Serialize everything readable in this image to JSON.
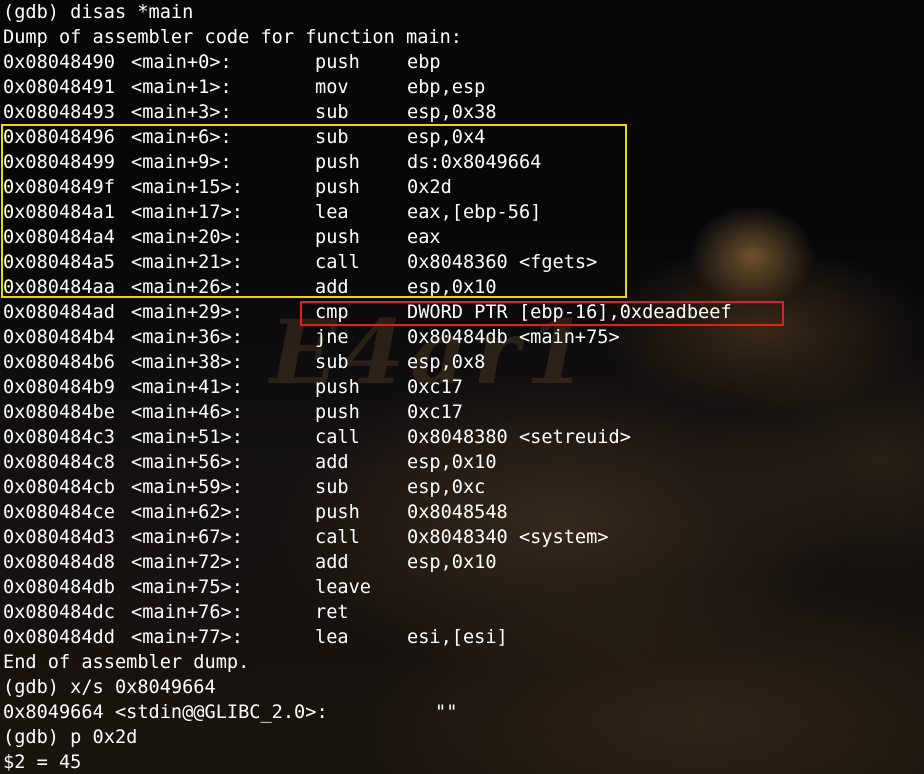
{
  "header": {
    "command": "(gdb) disas *main",
    "dump_title": "Dump of assembler code for function main:"
  },
  "instructions": [
    {
      "addr": "0x08048490",
      "offset": "<main+0>:",
      "mnemonic": "push",
      "operand": "ebp"
    },
    {
      "addr": "0x08048491",
      "offset": "<main+1>:",
      "mnemonic": "mov",
      "operand": "ebp,esp"
    },
    {
      "addr": "0x08048493",
      "offset": "<main+3>:",
      "mnemonic": "sub",
      "operand": "esp,0x38"
    },
    {
      "addr": "0x08048496",
      "offset": "<main+6>:",
      "mnemonic": "sub",
      "operand": "esp,0x4"
    },
    {
      "addr": "0x08048499",
      "offset": "<main+9>:",
      "mnemonic": "push",
      "operand": "ds:0x8049664"
    },
    {
      "addr": "0x0804849f",
      "offset": "<main+15>:",
      "mnemonic": "push",
      "operand": "0x2d"
    },
    {
      "addr": "0x080484a1",
      "offset": "<main+17>:",
      "mnemonic": "lea",
      "operand": "eax,[ebp-56]"
    },
    {
      "addr": "0x080484a4",
      "offset": "<main+20>:",
      "mnemonic": "push",
      "operand": "eax"
    },
    {
      "addr": "0x080484a5",
      "offset": "<main+21>:",
      "mnemonic": "call",
      "operand": "0x8048360 <fgets>"
    },
    {
      "addr": "0x080484aa",
      "offset": "<main+26>:",
      "mnemonic": "add",
      "operand": "esp,0x10"
    },
    {
      "addr": "0x080484ad",
      "offset": "<main+29>:",
      "mnemonic": "cmp",
      "operand": "DWORD PTR [ebp-16],0xdeadbeef"
    },
    {
      "addr": "0x080484b4",
      "offset": "<main+36>:",
      "mnemonic": "jne",
      "operand": "0x80484db <main+75>"
    },
    {
      "addr": "0x080484b6",
      "offset": "<main+38>:",
      "mnemonic": "sub",
      "operand": "esp,0x8"
    },
    {
      "addr": "0x080484b9",
      "offset": "<main+41>:",
      "mnemonic": "push",
      "operand": "0xc17"
    },
    {
      "addr": "0x080484be",
      "offset": "<main+46>:",
      "mnemonic": "push",
      "operand": "0xc17"
    },
    {
      "addr": "0x080484c3",
      "offset": "<main+51>:",
      "mnemonic": "call",
      "operand": "0x8048380 <setreuid>"
    },
    {
      "addr": "0x080484c8",
      "offset": "<main+56>:",
      "mnemonic": "add",
      "operand": "esp,0x10"
    },
    {
      "addr": "0x080484cb",
      "offset": "<main+59>:",
      "mnemonic": "sub",
      "operand": "esp,0xc"
    },
    {
      "addr": "0x080484ce",
      "offset": "<main+62>:",
      "mnemonic": "push",
      "operand": "0x8048548"
    },
    {
      "addr": "0x080484d3",
      "offset": "<main+67>:",
      "mnemonic": "call",
      "operand": "0x8048340 <system>"
    },
    {
      "addr": "0x080484d8",
      "offset": "<main+72>:",
      "mnemonic": "add",
      "operand": "esp,0x10"
    },
    {
      "addr": "0x080484db",
      "offset": "<main+75>:",
      "mnemonic": "leave",
      "operand": ""
    },
    {
      "addr": "0x080484dc",
      "offset": "<main+76>:",
      "mnemonic": "ret",
      "operand": ""
    },
    {
      "addr": "0x080484dd",
      "offset": "<main+77>:",
      "mnemonic": "lea",
      "operand": "esi,[esi]"
    }
  ],
  "footer": {
    "end_line": "End of assembler dump.",
    "xs_command": "(gdb) x/s 0x8049664",
    "xs_result_label": "0x8049664 <stdin@@GLIBC_2.0>:",
    "xs_result_value": "\"\"",
    "p_command": "(gdb) p 0x2d",
    "p_result": "$2 = 45"
  },
  "highlights": {
    "yellow_color": "#f1d21b",
    "red_color": "#e02020"
  },
  "theme": {
    "foreground": "#ffffff",
    "background": "#000000"
  }
}
